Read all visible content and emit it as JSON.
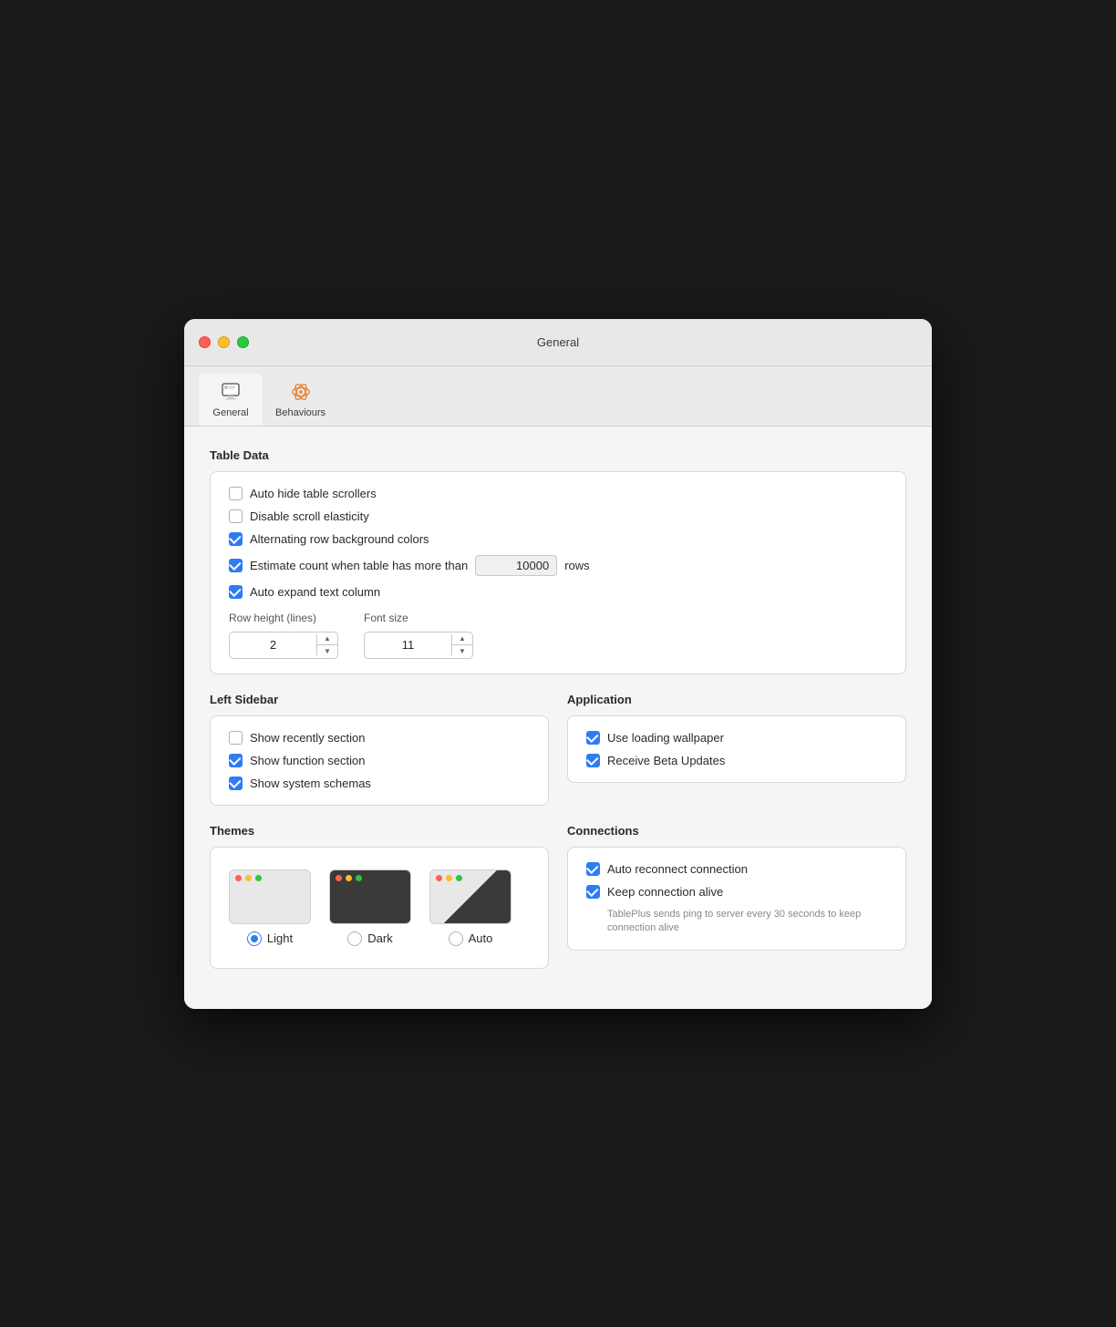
{
  "window": {
    "title": "General",
    "tabs": [
      {
        "id": "general",
        "label": "General",
        "active": true
      },
      {
        "id": "behaviours",
        "label": "Behaviours",
        "active": false
      }
    ]
  },
  "tableData": {
    "section_title": "Table Data",
    "checkboxes": [
      {
        "id": "auto_hide",
        "label": "Auto hide table scrollers",
        "checked": false
      },
      {
        "id": "disable_scroll",
        "label": "Disable scroll elasticity",
        "checked": false
      },
      {
        "id": "alternating_row",
        "label": "Alternating row background colors",
        "checked": true
      },
      {
        "id": "estimate_count",
        "label": "Estimate count when table has more than",
        "checked": true
      },
      {
        "id": "auto_expand",
        "label": "Auto expand text column",
        "checked": true
      }
    ],
    "estimate_value": "10000",
    "estimate_suffix": "rows",
    "row_height_label": "Row height (lines)",
    "row_height_value": "2",
    "font_size_label": "Font size",
    "font_size_value": "11"
  },
  "leftSidebar": {
    "section_title": "Left Sidebar",
    "checkboxes": [
      {
        "id": "show_recently",
        "label": "Show recently section",
        "checked": false
      },
      {
        "id": "show_function",
        "label": "Show function section",
        "checked": true
      },
      {
        "id": "show_system",
        "label": "Show system schemas",
        "checked": true
      }
    ]
  },
  "application": {
    "section_title": "Application",
    "checkboxes": [
      {
        "id": "use_wallpaper",
        "label": "Use loading wallpaper",
        "checked": true
      },
      {
        "id": "beta_updates",
        "label": "Receive Beta Updates",
        "checked": true
      }
    ]
  },
  "themes": {
    "section_title": "Themes",
    "options": [
      {
        "id": "light",
        "label": "Light",
        "selected": true
      },
      {
        "id": "dark",
        "label": "Dark",
        "selected": false
      },
      {
        "id": "auto",
        "label": "Auto",
        "selected": false
      }
    ]
  },
  "connections": {
    "section_title": "Connections",
    "checkboxes": [
      {
        "id": "auto_reconnect",
        "label": "Auto reconnect connection",
        "checked": true
      },
      {
        "id": "keep_alive",
        "label": "Keep connection alive",
        "checked": true
      }
    ],
    "note": "TablePlus sends ping to server every 30 seconds to keep connection alive"
  }
}
